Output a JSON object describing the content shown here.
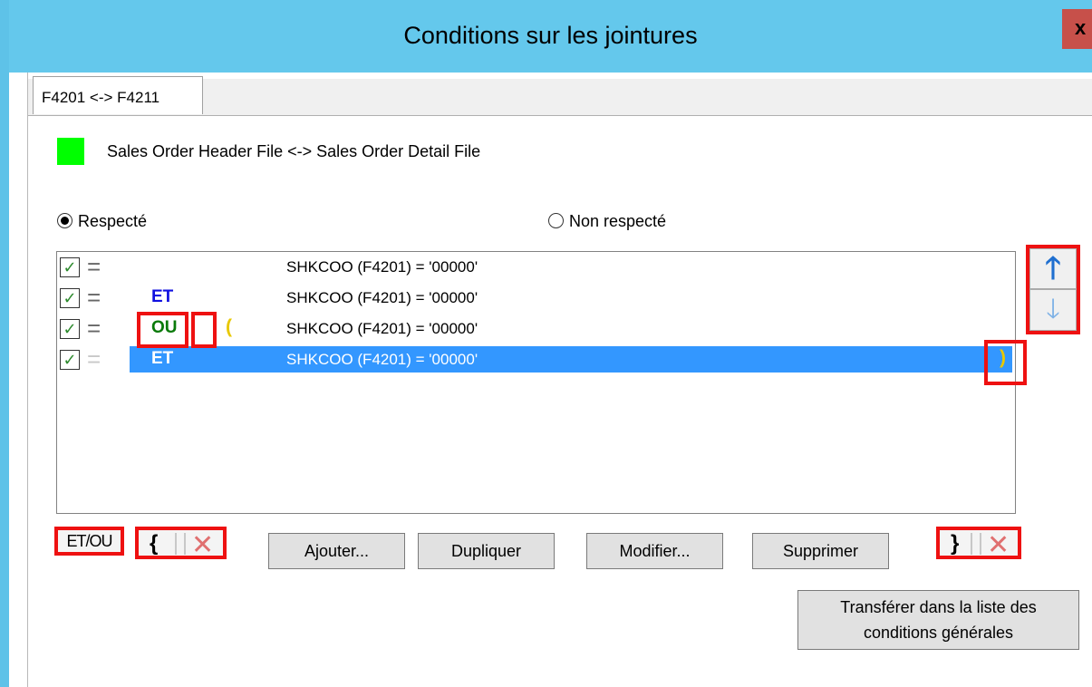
{
  "window": {
    "title": "Conditions sur les jointures",
    "close_label": "x"
  },
  "tab": {
    "label": "F4201 <-> F4211"
  },
  "legend": {
    "color": "#00ff00",
    "text": "Sales Order Header File <-> Sales Order Detail File"
  },
  "radios": {
    "respecte": "Respecté",
    "non_respecte": "Non respecté",
    "selected": "respecte"
  },
  "conditions": [
    {
      "checked": true,
      "operator": "",
      "open_paren": "",
      "condition": "SHKCOO (F4201) = '00000'",
      "close_paren": ""
    },
    {
      "checked": true,
      "operator": "ET",
      "open_paren": "",
      "condition": "SHKCOO (F4201) = '00000'",
      "close_paren": ""
    },
    {
      "checked": true,
      "operator": "OU",
      "open_paren": "(",
      "condition": "SHKCOO (F4201) = '00000'",
      "close_paren": ""
    },
    {
      "checked": true,
      "operator": "ET",
      "open_paren": "",
      "condition": "SHKCOO (F4201) = '00000'",
      "close_paren": ")",
      "selected": true
    }
  ],
  "buttons": {
    "et_ou": "ET/OU",
    "brace_open": "{",
    "brace_close": "}",
    "ajouter": "Ajouter...",
    "dupliquer": "Dupliquer",
    "modifier": "Modifier...",
    "supprimer": "Supprimer",
    "transferer_line1": "Transférer dans la liste des",
    "transferer_line2": "conditions générales"
  },
  "icons": {
    "move_up": "arrow-up-icon",
    "move_down": "arrow-down-icon",
    "delete": "red-x-icon"
  },
  "colors": {
    "title_bar": "#64c8ec",
    "selection": "#3397ff",
    "highlight_box": "#ee1111",
    "et_color": "#1010e0",
    "ou_color": "#0a7a0a",
    "paren_color": "#e8c800"
  }
}
